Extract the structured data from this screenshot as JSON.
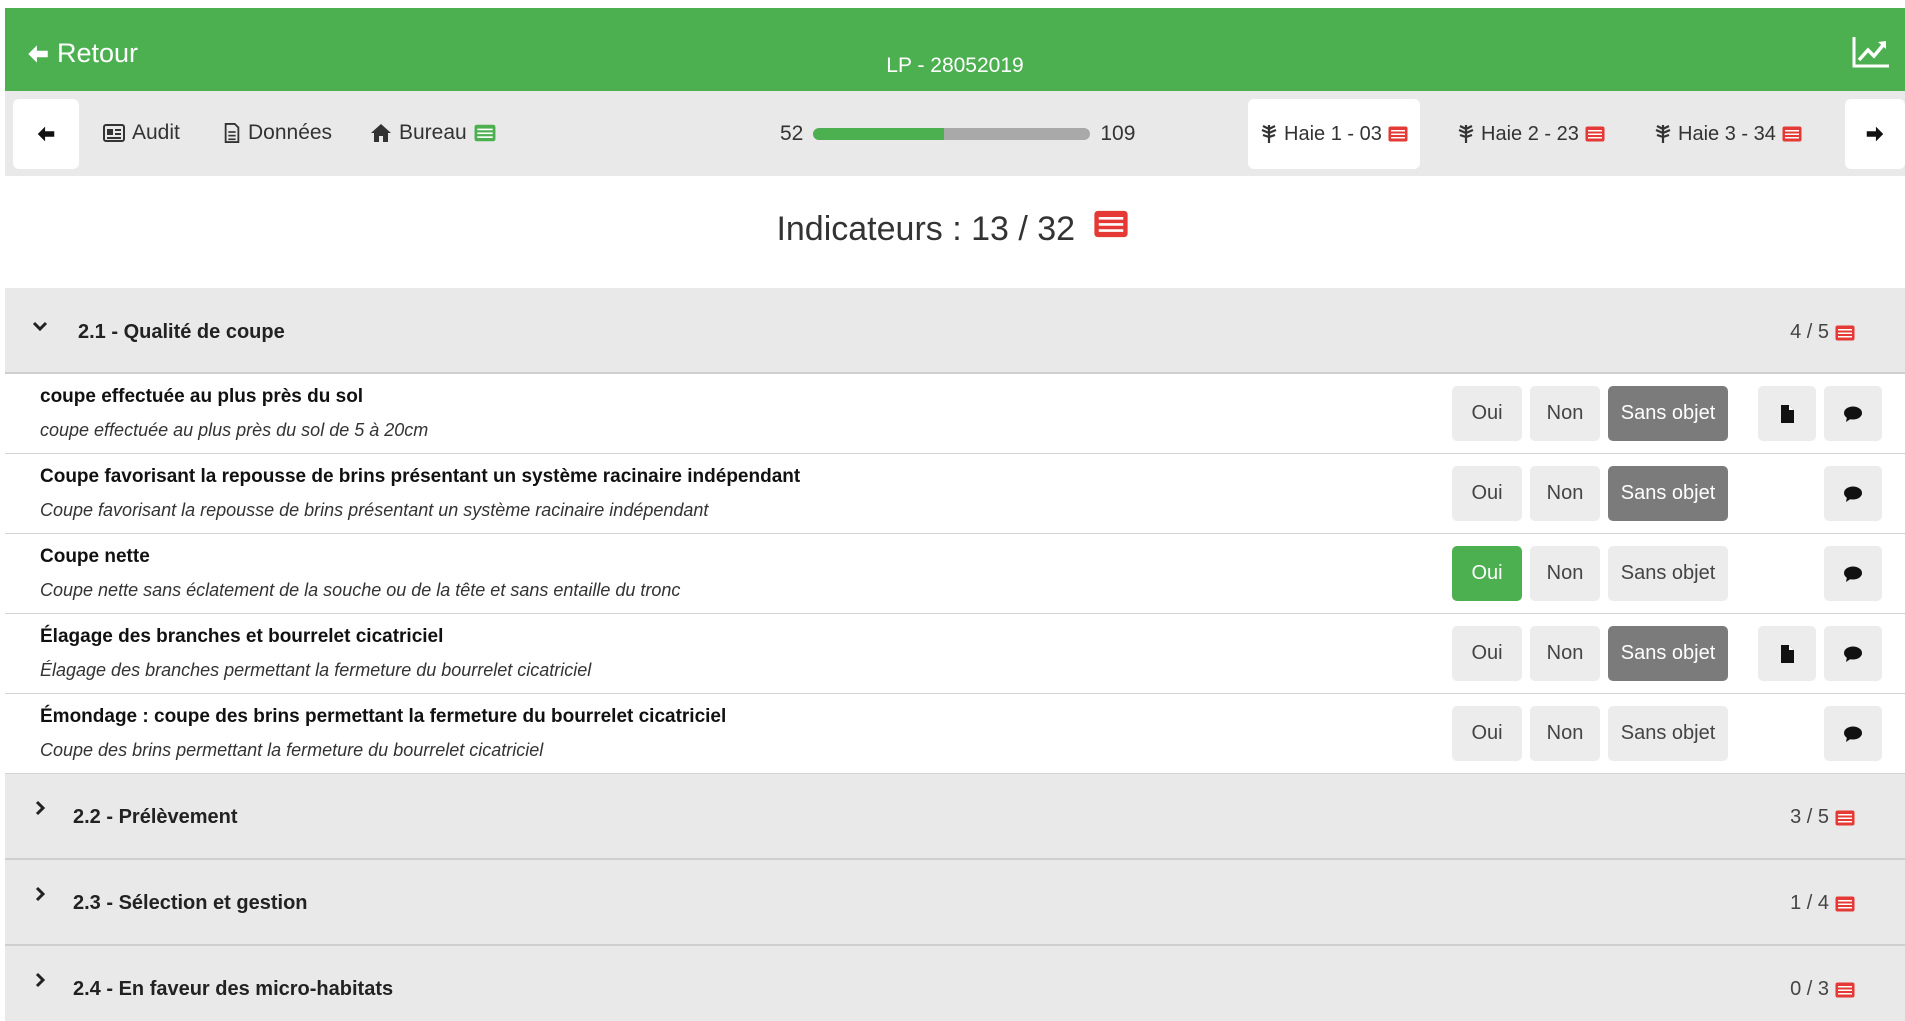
{
  "header": {
    "back_label": "Retour",
    "title": "LP - 28052019"
  },
  "toolbar": {
    "audit_label": "Audit",
    "donnees_label": "Données",
    "bureau_label": "Bureau",
    "progress_min": "52",
    "progress_max": "109",
    "progress_fraction": 0.47,
    "haies": [
      {
        "label": "Haie 1 - 03",
        "active": true
      },
      {
        "label": "Haie 2 - 23",
        "active": false
      },
      {
        "label": "Haie 3 - 34",
        "active": false
      }
    ]
  },
  "indicators_heading": "Indicateurs : 13 / 32",
  "sections": [
    {
      "title": "2.1 - Qualité de coupe",
      "count": "4 / 5",
      "expanded": true
    },
    {
      "title": "2.2 - Prélèvement",
      "count": "3 / 5",
      "expanded": false
    },
    {
      "title": "2.3 - Sélection et gestion",
      "count": "1 / 4",
      "expanded": false
    },
    {
      "title": "2.4 - En faveur des micro-habitats",
      "count": "0 / 3",
      "expanded": false
    }
  ],
  "buttons": {
    "oui": "Oui",
    "non": "Non",
    "sans_objet": "Sans objet"
  },
  "indicators": [
    {
      "title": "coupe effectuée au plus près du sol",
      "description": "coupe effectuée au plus près du sol de 5 à 20cm",
      "selected": "sans_objet",
      "has_document": true
    },
    {
      "title": "Coupe favorisant la repousse de brins présentant un système racinaire indépendant",
      "description": "Coupe favorisant la repousse de brins présentant un système racinaire indépendant",
      "selected": "sans_objet",
      "has_document": false
    },
    {
      "title": "Coupe nette",
      "description": "Coupe nette sans éclatement de la souche ou de la tête et sans entaille du tronc",
      "selected": "oui",
      "has_document": false
    },
    {
      "title": "Élagage des branches et bourrelet cicatriciel",
      "description": "Élagage des branches permettant la fermeture du bourrelet cicatriciel",
      "selected": "sans_objet",
      "has_document": true
    },
    {
      "title": "Émondage : coupe des brins permettant la fermeture du bourrelet cicatriciel",
      "description": "Coupe des brins permettant la fermeture du bourrelet cicatriciel",
      "selected": "none",
      "has_document": false
    }
  ],
  "colors": {
    "brand_green": "#4caf50",
    "selected_grey": "#7b7b7b",
    "list_icon_red": "#e53935",
    "bureau_icon_green": "#4caf50"
  }
}
